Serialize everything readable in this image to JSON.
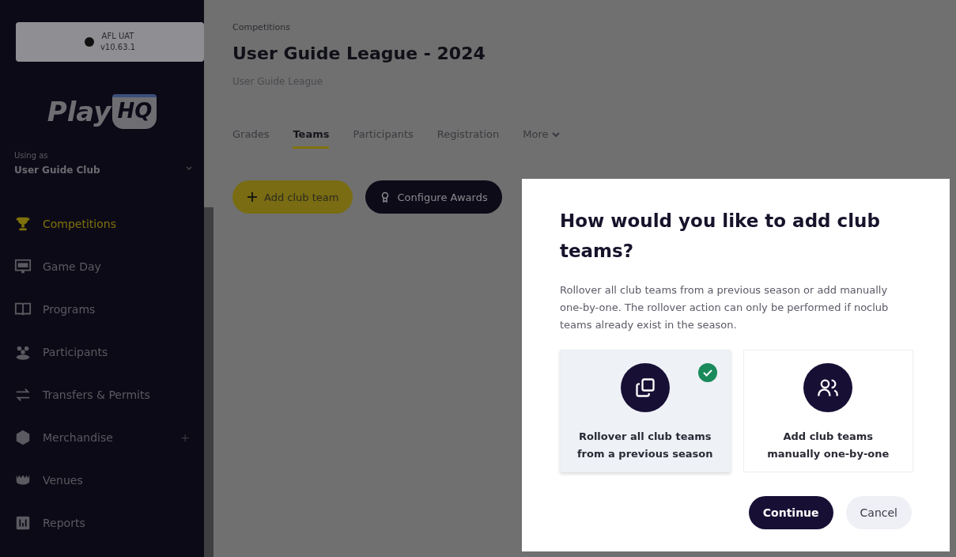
{
  "sidebar": {
    "environment": {
      "name": "AFL UAT",
      "version": "v10.63.1"
    },
    "logo": {
      "text": "Play",
      "badge": "HQ"
    },
    "using_as": {
      "label": "Using as",
      "value": "User Guide Club"
    },
    "items": [
      {
        "label": "Competitions",
        "kind": "trophy",
        "selected": true
      },
      {
        "label": "Game Day",
        "kind": "scoreboard",
        "selected": false
      },
      {
        "label": "Programs",
        "kind": "book",
        "selected": false
      },
      {
        "label": "Participants",
        "kind": "people",
        "selected": false
      },
      {
        "label": "Transfers & Permits",
        "kind": "arrows",
        "selected": false
      },
      {
        "label": "Merchandise",
        "kind": "box",
        "selected": false,
        "suffix": "+"
      },
      {
        "label": "Venues",
        "kind": "stadium",
        "selected": false
      },
      {
        "label": "Reports",
        "kind": "report",
        "selected": false
      }
    ]
  },
  "page": {
    "breadcrumb": "Competitions",
    "title": "User Guide League - 2024",
    "subtitle": "User Guide League",
    "tabs": [
      {
        "label": "Grades",
        "selected": false
      },
      {
        "label": "Teams",
        "selected": true
      },
      {
        "label": "Participants",
        "selected": false
      },
      {
        "label": "Registration",
        "selected": false
      },
      {
        "label": "More",
        "selected": false,
        "dropdown": true
      }
    ],
    "actions": [
      {
        "label": "Add club team",
        "kind": "primary"
      },
      {
        "label": "Configure Awards",
        "kind": "dark"
      }
    ]
  },
  "dialog": {
    "title": "How would you like to add club teams?",
    "description": "Rollover all club teams from a previous season or add manually one-by-one. The rollover action can only be performed if noclub teams already exist in the season.",
    "options": [
      {
        "label": "Rollover all club teams from a previous season",
        "kind": "rollover",
        "selected": true
      },
      {
        "label": "Add club teams manually one-by-one",
        "kind": "manual",
        "selected": false
      }
    ],
    "buttons": [
      {
        "label": "Continue",
        "kind": "primary"
      },
      {
        "label": "Cancel",
        "kind": "secondary"
      }
    ]
  }
}
